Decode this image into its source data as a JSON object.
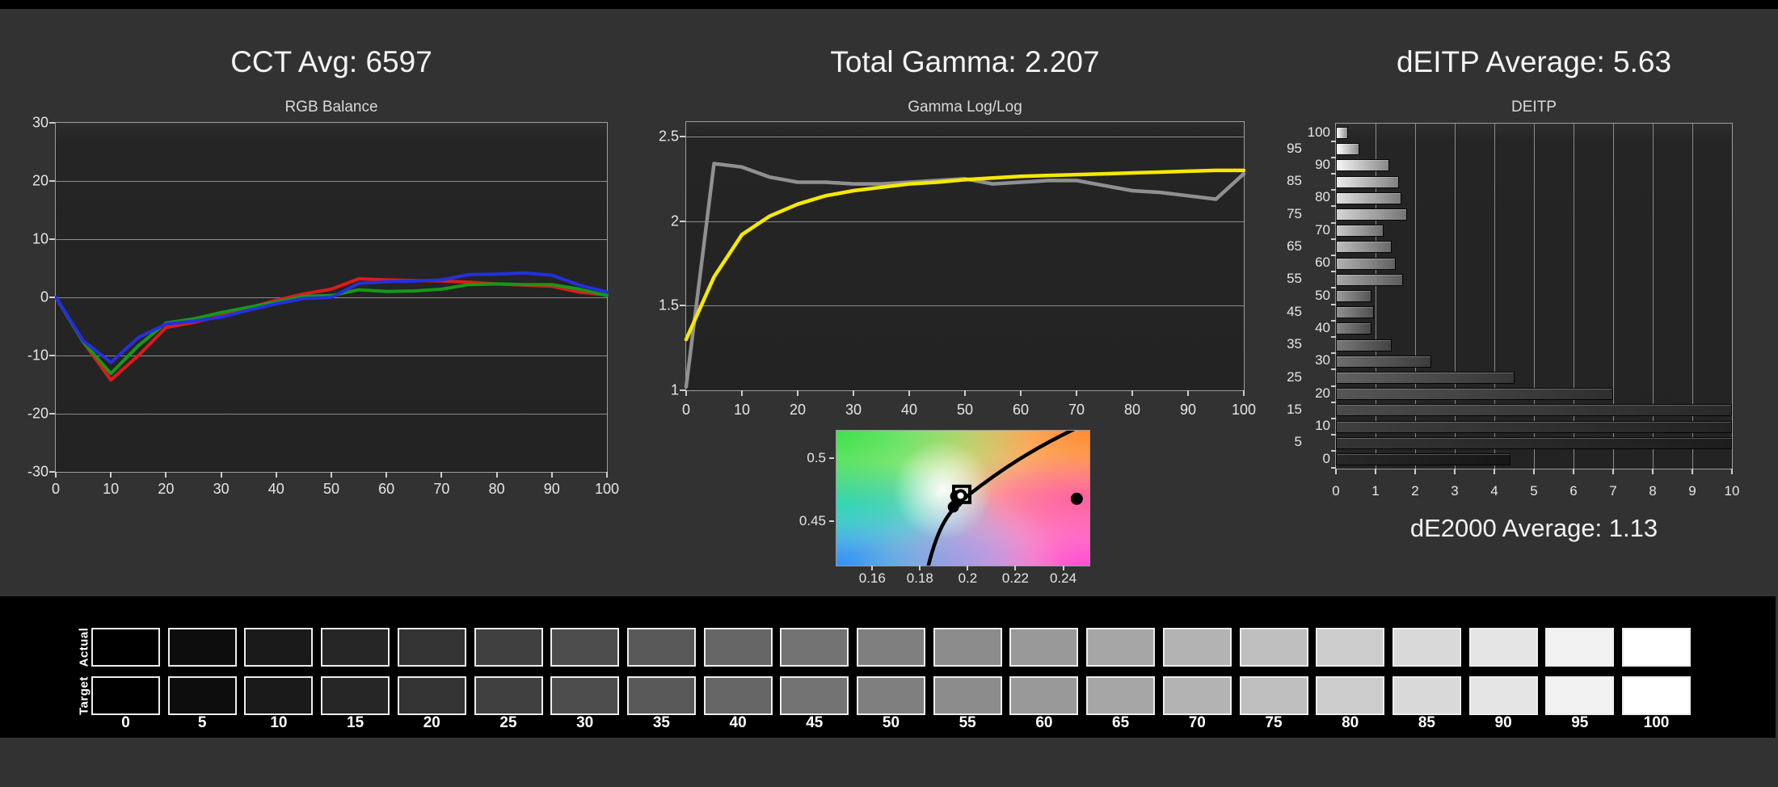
{
  "page": {
    "background": "#323232",
    "top_bar_color": "#000000"
  },
  "chart_data": [
    {
      "id": "rgb_balance",
      "type": "line",
      "title": "CCT Avg: 6597",
      "subtitle": "RGB Balance",
      "xlim": [
        0,
        100
      ],
      "ylim": [
        -30,
        30
      ],
      "x_ticks": [
        0,
        10,
        20,
        30,
        40,
        50,
        60,
        70,
        80,
        90,
        100
      ],
      "y_ticks": [
        30,
        20,
        10,
        0,
        -10,
        -20,
        -30
      ],
      "grid": true,
      "x": [
        0,
        5,
        10,
        15,
        20,
        25,
        30,
        35,
        40,
        45,
        50,
        55,
        60,
        65,
        70,
        75,
        80,
        85,
        90,
        95,
        100
      ],
      "series": [
        {
          "name": "red",
          "color": "#e01a1a",
          "values": [
            0,
            -7.7,
            -14.2,
            -10.0,
            -5.2,
            -4.3,
            -3.2,
            -1.8,
            -0.5,
            0.6,
            1.4,
            3.2,
            3.0,
            2.9,
            2.8,
            2.6,
            2.3,
            2.1,
            1.9,
            0.9,
            0.4
          ]
        },
        {
          "name": "green",
          "color": "#169916",
          "values": [
            0,
            -7.7,
            -13.1,
            -8.3,
            -4.4,
            -3.7,
            -2.6,
            -1.7,
            -0.8,
            0.2,
            0.3,
            1.3,
            1.0,
            1.1,
            1.4,
            2.2,
            2.3,
            2.2,
            2.2,
            1.4,
            0.3
          ]
        },
        {
          "name": "blue",
          "color": "#2430e0",
          "values": [
            0,
            -7.5,
            -11.2,
            -6.9,
            -4.6,
            -4.1,
            -3.4,
            -2.2,
            -1.1,
            -0.2,
            0.0,
            2.4,
            2.7,
            2.8,
            3.0,
            3.9,
            4.0,
            4.2,
            3.8,
            2.1,
            0.9
          ]
        }
      ]
    },
    {
      "id": "gamma",
      "type": "line",
      "title": "Total Gamma: 2.207",
      "subtitle": "Gamma Log/Log",
      "xlim": [
        0,
        100
      ],
      "ylim": [
        1,
        2.586
      ],
      "x_ticks": [
        0,
        10,
        20,
        30,
        40,
        50,
        60,
        70,
        80,
        90,
        100
      ],
      "y_ticks": [
        2.5,
        2,
        1.5,
        1
      ],
      "grid": true,
      "x": [
        0,
        5,
        10,
        15,
        20,
        25,
        30,
        35,
        40,
        45,
        50,
        55,
        60,
        65,
        70,
        75,
        80,
        85,
        90,
        95,
        100
      ],
      "series": [
        {
          "name": "measured",
          "color": "#909090",
          "values": [
            1.02,
            2.34,
            2.32,
            2.26,
            2.23,
            2.23,
            2.22,
            2.22,
            2.23,
            2.24,
            2.25,
            2.22,
            2.23,
            2.24,
            2.24,
            2.21,
            2.18,
            2.17,
            2.15,
            2.13,
            2.28
          ]
        },
        {
          "name": "target",
          "color": "#f6e800",
          "values": [
            1.3,
            1.67,
            1.92,
            2.03,
            2.1,
            2.15,
            2.18,
            2.2,
            2.22,
            2.23,
            2.245,
            2.255,
            2.265,
            2.27,
            2.275,
            2.28,
            2.285,
            2.29,
            2.295,
            2.3,
            2.3
          ]
        }
      ]
    },
    {
      "id": "cie_white_point",
      "type": "scatter",
      "title": "",
      "xlim": [
        0.145,
        0.251
      ],
      "ylim": [
        0.415,
        0.522
      ],
      "x_ticks": [
        0.16,
        0.18,
        0.2,
        0.22,
        0.24
      ],
      "y_ticks": [
        0.5,
        0.45
      ],
      "points": {
        "measured_cluster": [
          [
            0.195,
            0.47
          ],
          [
            0.1955,
            0.4655
          ],
          [
            0.194,
            0.4615
          ]
        ],
        "white_marker": [
          0.197,
          0.4705
        ],
        "target_square": [
          0.1975,
          0.4715
        ],
        "outlier": [
          0.2457,
          0.468
        ]
      },
      "locus_color": "#000000"
    },
    {
      "id": "deitp",
      "type": "bar",
      "title": "dEITP Average: 5.63",
      "subtitle": "DEITP",
      "footer": "dE2000 Average: 1.13",
      "xlim": [
        0,
        10
      ],
      "x_ticks": [
        0,
        1,
        2,
        3,
        4,
        5,
        6,
        7,
        8,
        9,
        10
      ],
      "categories": [
        100,
        95,
        90,
        85,
        80,
        75,
        70,
        65,
        60,
        55,
        50,
        45,
        40,
        35,
        30,
        25,
        20,
        15,
        10,
        5,
        0
      ],
      "values": [
        0.3,
        0.6,
        1.35,
        1.6,
        1.65,
        1.8,
        1.2,
        1.4,
        1.5,
        1.7,
        0.9,
        0.95,
        0.9,
        1.4,
        2.4,
        4.5,
        7.0,
        10,
        10,
        10,
        4.4
      ]
    }
  ],
  "strip": {
    "row_labels": [
      "Actual",
      "Target"
    ],
    "levels": [
      0,
      5,
      10,
      15,
      20,
      25,
      30,
      35,
      40,
      45,
      50,
      55,
      60,
      65,
      70,
      75,
      80,
      85,
      90,
      95,
      100
    ]
  }
}
